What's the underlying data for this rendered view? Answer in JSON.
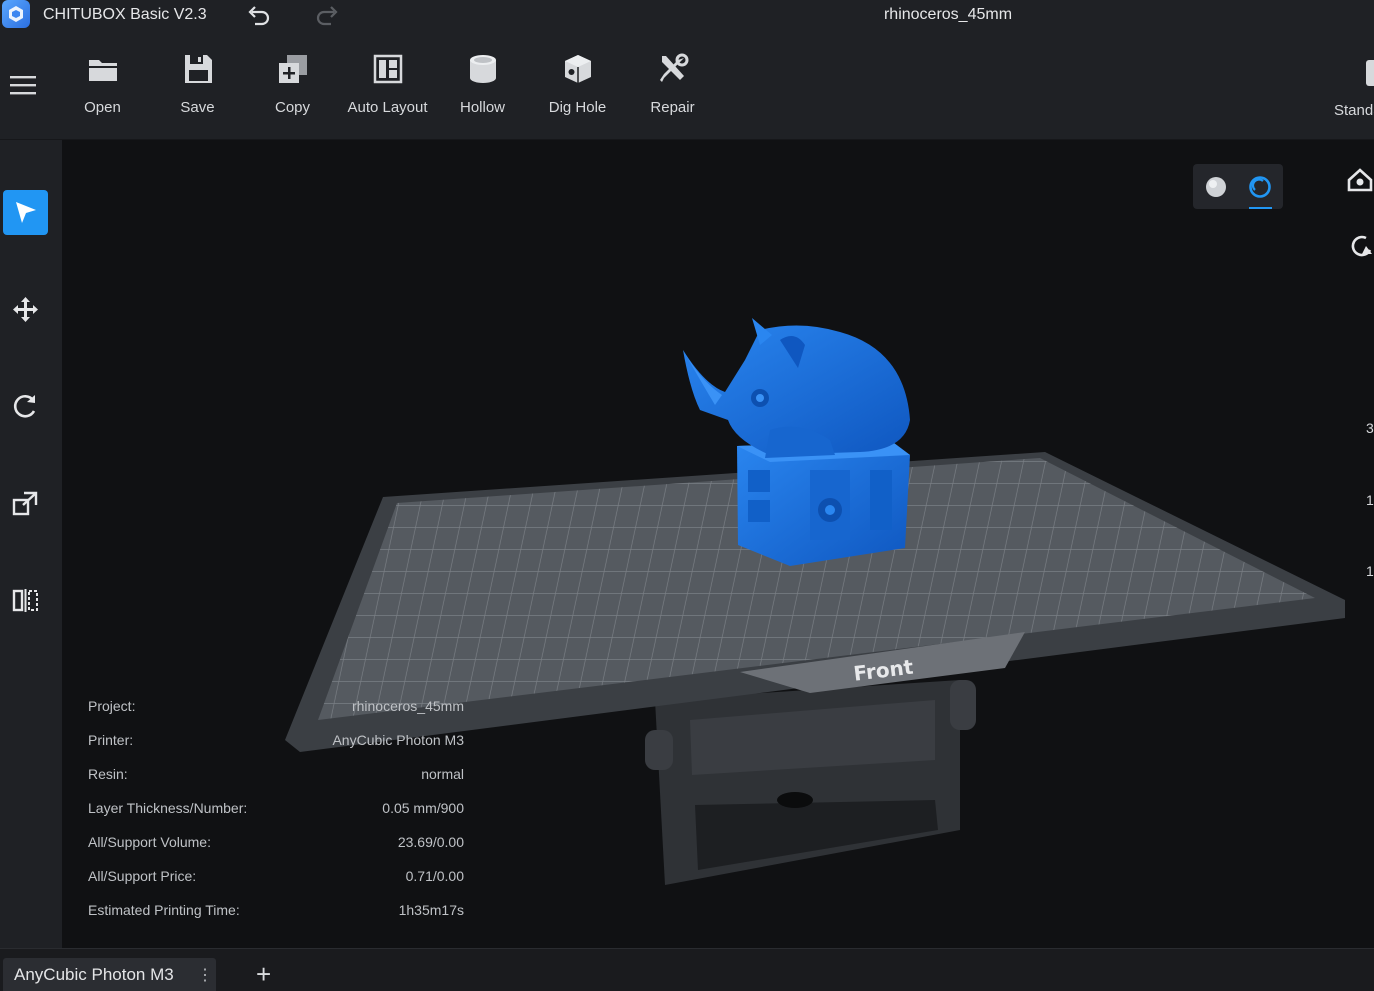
{
  "titlebar": {
    "app_title": "CHITUBOX Basic V2.3",
    "document_title": "rhinoceros_45mm",
    "icons": [
      "app-logo-icon",
      "undo-icon",
      "redo-icon"
    ]
  },
  "toolbar": {
    "tools": [
      {
        "label": "Open",
        "icon": "folder-icon"
      },
      {
        "label": "Save",
        "icon": "floppy-disk-icon"
      },
      {
        "label": "Copy",
        "icon": "copy-icon"
      },
      {
        "label": "Auto Layout",
        "icon": "auto-layout-icon"
      },
      {
        "label": "Hollow",
        "icon": "hollow-cylinder-icon"
      },
      {
        "label": "Dig Hole",
        "icon": "dig-hole-cube-icon"
      },
      {
        "label": "Repair",
        "icon": "repair-tools-icon"
      }
    ],
    "standard_label": "Standa"
  },
  "left_tools": [
    {
      "name": "select",
      "icon": "cursor-arrow-icon",
      "active": true
    },
    {
      "name": "move",
      "icon": "move-arrows-icon",
      "active": false
    },
    {
      "name": "rotate",
      "icon": "rotate-icon",
      "active": false
    },
    {
      "name": "scale",
      "icon": "scale-icon",
      "active": false
    },
    {
      "name": "mirror",
      "icon": "mirror-icon",
      "active": false
    }
  ],
  "viewport": {
    "bed_label": "Front",
    "model_color": "#1a6fd4",
    "edge_numbers": [
      "3",
      "1",
      "1"
    ]
  },
  "info": {
    "project_label": "Project:",
    "project_value": "rhinoceros_45mm",
    "printer_label": "Printer:",
    "printer_value": "AnyCubic Photon M3",
    "resin_label": "Resin:",
    "resin_value": "normal",
    "layer_label": "Layer Thickness/Number:",
    "layer_value": "0.05 mm/900",
    "volume_label": "All/Support Volume:",
    "volume_value": "23.69/0.00",
    "price_label": "All/Support Price:",
    "price_value": "0.71/0.00",
    "time_label": "Estimated Printing Time:",
    "time_value": "1h35m17s"
  },
  "bottom": {
    "printer_tab": "AnyCubic Photon M3",
    "more_glyph": "⋮",
    "add_glyph": "+"
  },
  "colors": {
    "accent": "#2196f3",
    "panel": "#1f2125",
    "background": "#101113"
  }
}
